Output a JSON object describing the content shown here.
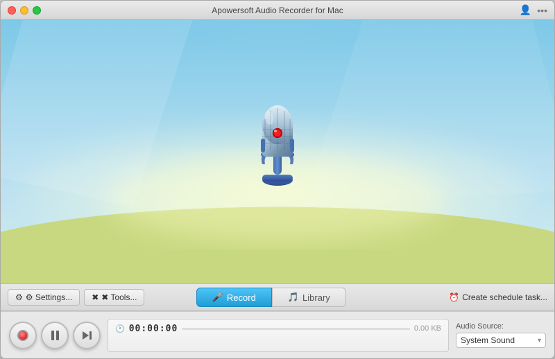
{
  "titleBar": {
    "title": "Apowersoft Audio Recorder for Mac"
  },
  "toolbar": {
    "settingsLabel": "⚙ Settings...",
    "toolsLabel": "✖ Tools...",
    "recordTab": "Record",
    "libraryTab": "Library",
    "scheduleLabel": "Create schedule task...",
    "activeTab": "record"
  },
  "controls": {
    "timeDisplay": "00:00:00",
    "fileSize": "0.00 KB",
    "audioSourceLabel": "Audio Source:",
    "audioSourceValue": "System Sound"
  },
  "icons": {
    "microphone": "mic-icon",
    "record": "record-icon",
    "pause": "pause-icon",
    "play": "play-icon",
    "skip": "skip-icon",
    "clock": "clock-icon",
    "schedule": "schedule-icon"
  }
}
